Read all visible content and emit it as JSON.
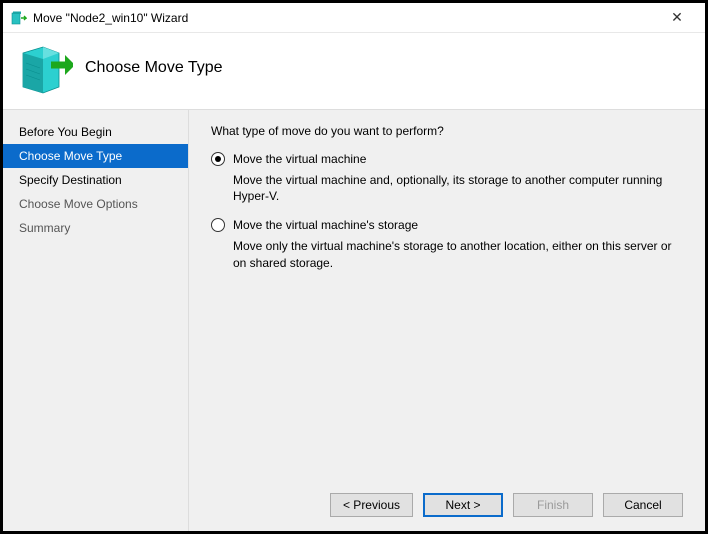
{
  "window": {
    "title": "Move \"Node2_win10\" Wizard"
  },
  "banner": {
    "title": "Choose Move Type"
  },
  "sidebar": {
    "items": [
      {
        "label": "Before You Begin",
        "state": "visited"
      },
      {
        "label": "Choose Move Type",
        "state": "active"
      },
      {
        "label": "Specify Destination",
        "state": "visited"
      },
      {
        "label": "Choose Move Options",
        "state": "future"
      },
      {
        "label": "Summary",
        "state": "future"
      }
    ]
  },
  "content": {
    "prompt": "What type of move do you want to perform?",
    "options": [
      {
        "label": "Move the virtual machine",
        "desc": "Move the virtual machine and, optionally, its storage to another computer running Hyper-V.",
        "selected": true
      },
      {
        "label": "Move the virtual machine's storage",
        "desc": "Move only the virtual machine's storage to another location, either on this server or on shared storage.",
        "selected": false
      }
    ]
  },
  "footer": {
    "previous": "< Previous",
    "next": "Next >",
    "finish": "Finish",
    "cancel": "Cancel"
  }
}
